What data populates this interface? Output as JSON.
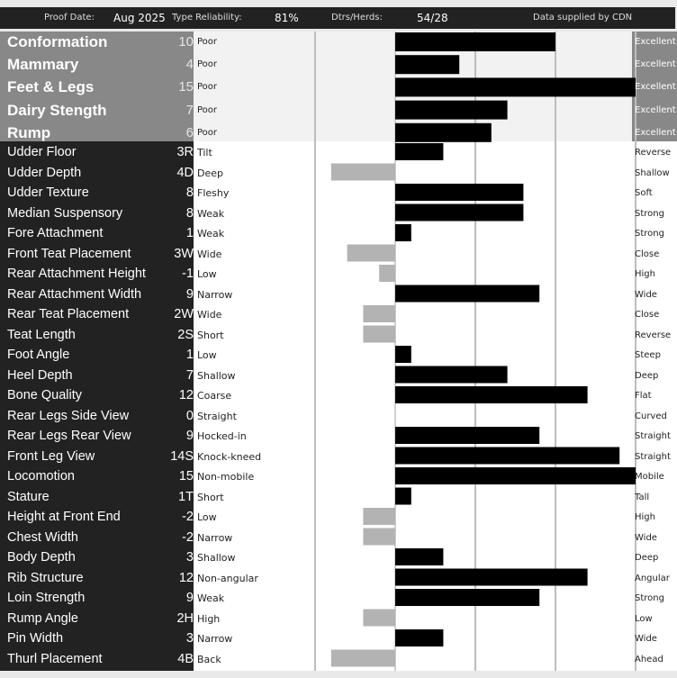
{
  "header": {
    "proof_date_label": "Proof Date:",
    "proof_date_value": "Aug 2025",
    "type_reliability_label": "Type Reliability:",
    "type_reliability_value": "81%",
    "dtrs_herds_label": "Dtrs/Herds:",
    "dtrs_herds_value": "54/28",
    "source_label": "Data supplied by CDN"
  },
  "chart_data": {
    "type": "bar",
    "orientation": "horizontal",
    "xlim": [
      -15,
      15
    ],
    "grid": true,
    "major_traits": [
      {
        "name": "Conformation",
        "display": "10",
        "value": 10,
        "low": "Poor",
        "high": "Excellent"
      },
      {
        "name": "Mammary",
        "display": "4",
        "value": 4,
        "low": "Poor",
        "high": "Excellent"
      },
      {
        "name": "Feet & Legs",
        "display": "15",
        "value": 15,
        "low": "Poor",
        "high": "Excellent"
      },
      {
        "name": "Dairy Stength",
        "display": "7",
        "value": 7,
        "low": "Poor",
        "high": "Excellent"
      },
      {
        "name": "Rump",
        "display": "6",
        "value": 6,
        "low": "Poor",
        "high": "Excellent"
      }
    ],
    "linear_traits": [
      {
        "name": "Udder Floor",
        "display": "3R",
        "value": 3,
        "low": "Tilt",
        "high": "Reverse"
      },
      {
        "name": "Udder Depth",
        "display": "4D",
        "value": -4,
        "low": "Deep",
        "high": "Shallow"
      },
      {
        "name": "Udder Texture",
        "display": "8",
        "value": 8,
        "low": "Fleshy",
        "high": "Soft"
      },
      {
        "name": "Median Suspensory",
        "display": "8",
        "value": 8,
        "low": "Weak",
        "high": "Strong"
      },
      {
        "name": "Fore Attachment",
        "display": "1",
        "value": 1,
        "low": "Weak",
        "high": "Strong"
      },
      {
        "name": "Front Teat Placement",
        "display": "3W",
        "value": -3,
        "low": "Wide",
        "high": "Close"
      },
      {
        "name": "Rear Attachment Height",
        "display": "-1",
        "value": -1,
        "low": "Low",
        "high": "High"
      },
      {
        "name": "Rear Attachment Width",
        "display": "9",
        "value": 9,
        "low": "Narrow",
        "high": "Wide"
      },
      {
        "name": "Rear Teat Placement",
        "display": "2W",
        "value": -2,
        "low": "Wide",
        "high": "Close"
      },
      {
        "name": "Teat Length",
        "display": "2S",
        "value": -2,
        "low": "Short",
        "high": "Reverse"
      },
      {
        "name": "Foot Angle",
        "display": "1",
        "value": 1,
        "low": "Low",
        "high": "Steep"
      },
      {
        "name": "Heel Depth",
        "display": "7",
        "value": 7,
        "low": "Shallow",
        "high": "Deep"
      },
      {
        "name": "Bone Quality",
        "display": "12",
        "value": 12,
        "low": "Coarse",
        "high": "Flat"
      },
      {
        "name": "Rear Legs Side View",
        "display": "0",
        "value": 0,
        "low": "Straight",
        "high": "Curved"
      },
      {
        "name": "Rear Legs Rear View",
        "display": "9",
        "value": 9,
        "low": "Hocked-in",
        "high": "Straight"
      },
      {
        "name": "Front Leg View",
        "display": "14S",
        "value": 14,
        "low": "Knock-kneed",
        "high": "Straight"
      },
      {
        "name": "Locomotion",
        "display": "15",
        "value": 15,
        "low": "Non-mobile",
        "high": "Mobile"
      },
      {
        "name": "Stature",
        "display": "1T",
        "value": 1,
        "low": "Short",
        "high": "Tall"
      },
      {
        "name": "Height at Front End",
        "display": "-2",
        "value": -2,
        "low": "Low",
        "high": "High"
      },
      {
        "name": "Chest Width",
        "display": "-2",
        "value": -2,
        "low": "Narrow",
        "high": "Wide"
      },
      {
        "name": "Body Depth",
        "display": "3",
        "value": 3,
        "low": "Shallow",
        "high": "Deep"
      },
      {
        "name": "Rib Structure",
        "display": "12",
        "value": 12,
        "low": "Non-angular",
        "high": "Angular"
      },
      {
        "name": "Loin Strength",
        "display": "9",
        "value": 9,
        "low": "Weak",
        "high": "Strong"
      },
      {
        "name": "Rump Angle",
        "display": "2H",
        "value": -2,
        "low": "High",
        "high": "Low"
      },
      {
        "name": "Pin Width",
        "display": "3",
        "value": 3,
        "low": "Narrow",
        "high": "Wide"
      },
      {
        "name": "Thurl Placement",
        "display": "4B",
        "value": -4,
        "low": "Back",
        "high": "Ahead"
      }
    ],
    "colors": {
      "positive_bar": "#000000",
      "negative_bar": "#b3b3b3",
      "gridline": "#bdbdbd",
      "zero_line": "#cfcfcf"
    }
  }
}
